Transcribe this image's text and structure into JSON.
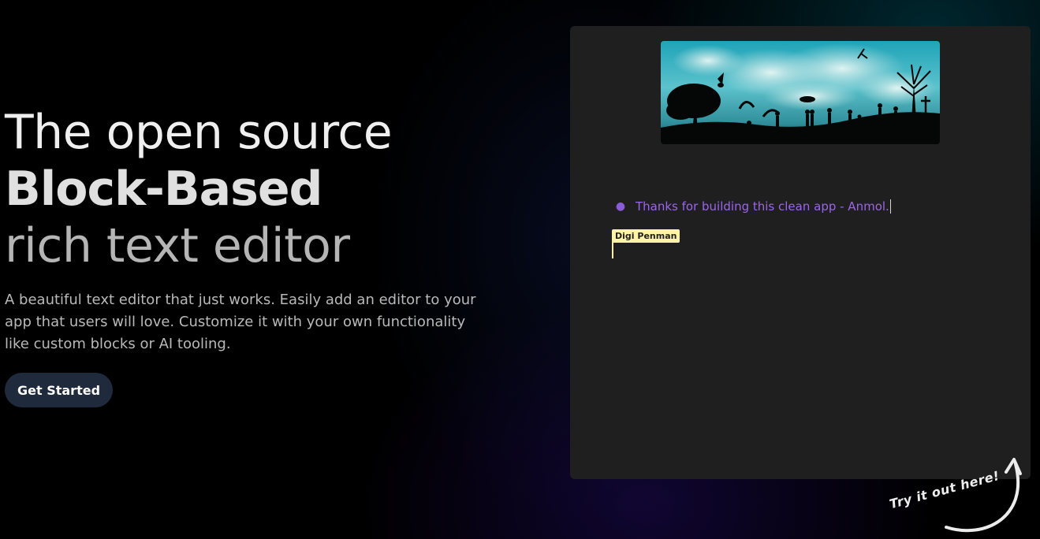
{
  "hero": {
    "title_line_1": "The open source",
    "title_line_2": "Block-Based",
    "title_line_3": "rich text editor",
    "description": "A beautiful text editor that just works. Easily add an editor to your app that users will love. Customize it with your own functionality like custom blocks or AI tooling.",
    "cta_label": "Get Started"
  },
  "editor": {
    "image_icon": "silhouette-landscape-image",
    "bullet_text": "Thanks for building this clean app - Anmol.",
    "collaborator_name": "Digi Penman"
  },
  "callout": {
    "text": "Try it out here!",
    "arrow_icon": "curved-arrow-icon"
  },
  "colors": {
    "background": "#000000",
    "editor_bg": "#1f1f1f",
    "button_bg": "#1f2a3c",
    "bullet_text": "#9b66ea",
    "collaborator_bg": "#fff3a6"
  }
}
